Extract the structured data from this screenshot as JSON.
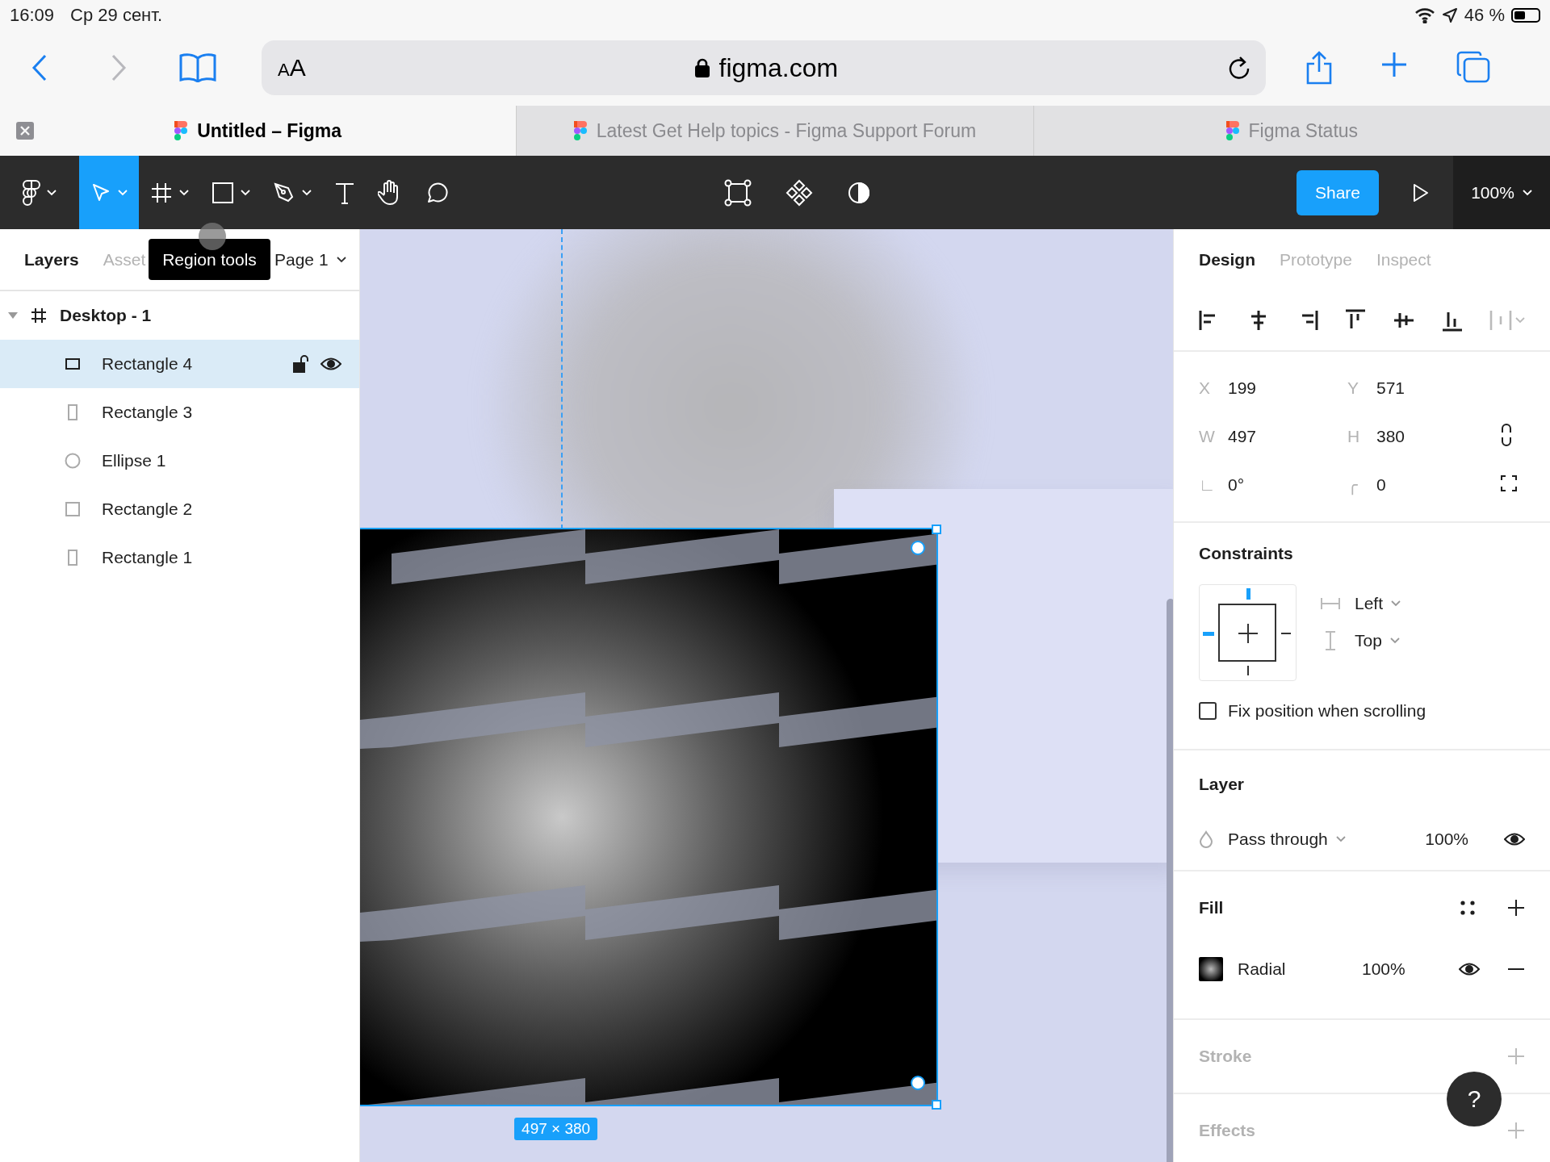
{
  "status_bar": {
    "time": "16:09",
    "date": "Ср 29 сент.",
    "battery": "46 %"
  },
  "browser": {
    "text_size": "AA",
    "address": "figma.com"
  },
  "browser_tabs": [
    {
      "title": "Untitled – Figma",
      "selected": true
    },
    {
      "title": "Latest Get Help topics - Figma Support Forum",
      "selected": false
    },
    {
      "title": "Figma Status",
      "selected": false
    }
  ],
  "toolbar": {
    "tools": [
      {
        "kind": "move",
        "selected": true,
        "caret": true
      },
      {
        "kind": "frame",
        "selected": false,
        "caret": true
      },
      {
        "kind": "shape",
        "selected": false,
        "caret": true
      },
      {
        "kind": "pen",
        "selected": false,
        "caret": true
      },
      {
        "kind": "text",
        "selected": false,
        "caret": false
      },
      {
        "kind": "hand",
        "selected": false,
        "caret": false
      },
      {
        "kind": "comment",
        "selected": false,
        "caret": false
      }
    ],
    "share": "Share",
    "zoom": "100%"
  },
  "left_panel": {
    "tabs": [
      {
        "label": "Layers",
        "selected": true
      },
      {
        "label": "Asset",
        "selected": false
      }
    ],
    "page": "Page 1",
    "tooltip": "Region tools",
    "layers": [
      {
        "name": "Desktop - 1",
        "kind": "frame",
        "expanded": true,
        "selected": false,
        "children": [
          {
            "name": "Rectangle 4",
            "kind": "wide",
            "selected": true
          },
          {
            "name": "Rectangle 3",
            "kind": "tall",
            "selected": false
          },
          {
            "name": "Ellipse 1",
            "kind": "ellipse",
            "selected": false
          },
          {
            "name": "Rectangle 2",
            "kind": "square",
            "selected": false
          },
          {
            "name": "Rectangle 1",
            "kind": "tall",
            "selected": false
          }
        ]
      }
    ]
  },
  "canvas": {
    "selection_size": "497 × 380"
  },
  "right_panel": {
    "tabs": [
      {
        "label": "Design",
        "selected": true
      },
      {
        "label": "Prototype",
        "selected": false
      },
      {
        "label": "Inspect",
        "selected": false
      }
    ],
    "properties": [
      {
        "label": "X",
        "value": "199"
      },
      {
        "label": "Y",
        "value": "571"
      },
      {
        "label": "W",
        "value": "497"
      },
      {
        "label": "H",
        "value": "380"
      },
      {
        "label": "∟",
        "value": "0°"
      },
      {
        "label": "╭",
        "value": "0"
      }
    ],
    "constraints": {
      "title": "Constraints",
      "pins": {
        "top": true,
        "left": true,
        "right": false,
        "bottom": false
      },
      "horizontal": "Left",
      "vertical": "Top",
      "fix_position": {
        "label": "Fix position when scrolling",
        "checked": false
      }
    },
    "layer": {
      "title": "Layer",
      "blend": "Pass through",
      "opacity": "100%"
    },
    "fill": {
      "title": "Fill",
      "type": "Radial",
      "opacity": "100%"
    },
    "stroke": {
      "title": "Stroke"
    },
    "effects": {
      "title": "Effects"
    },
    "help": "?"
  }
}
